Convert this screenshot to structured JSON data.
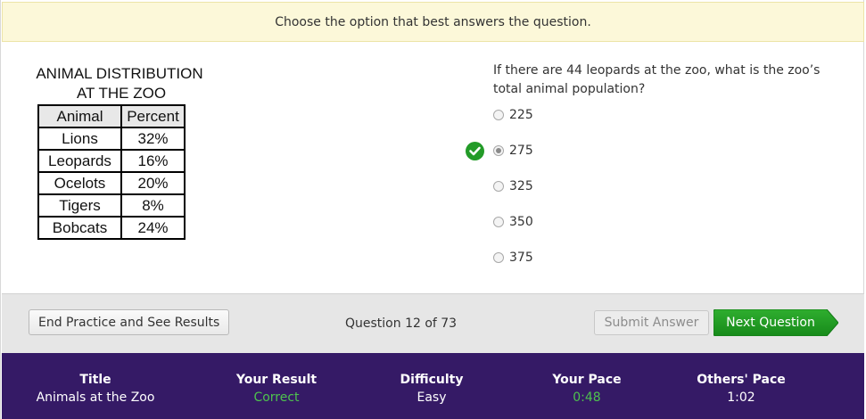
{
  "instruction": "Choose the option that best answers the question.",
  "figure": {
    "title_line1": "ANIMAL DISTRIBUTION",
    "title_line2": "AT THE ZOO",
    "headers": [
      "Animal",
      "Percent"
    ],
    "rows": [
      [
        "Lions",
        "32%"
      ],
      [
        "Leopards",
        "16%"
      ],
      [
        "Ocelots",
        "20%"
      ],
      [
        "Tigers",
        "8%"
      ],
      [
        "Bobcats",
        "24%"
      ]
    ]
  },
  "question": {
    "text": "If there are 44 leopards at the zoo, what is the zoo’s total animal population?",
    "options": [
      "225",
      "275",
      "325",
      "350",
      "375"
    ],
    "selected_index": 1,
    "correct_index": 1
  },
  "actions": {
    "end_label": "End Practice and See Results",
    "question_count": "Question 12 of 73",
    "submit_label": "Submit Answer",
    "next_label": "Next Question"
  },
  "footer": {
    "title_label": "Title",
    "title_value": "Animals at the Zoo",
    "result_label": "Your Result",
    "result_value": "Correct",
    "difficulty_label": "Difficulty",
    "difficulty_value": "Easy",
    "pace_label": "Your Pace",
    "pace_value": "0:48",
    "others_label": "Others' Pace",
    "others_value": "1:02"
  },
  "colors": {
    "footer_bg": "#351a66",
    "accent_green": "#239b28",
    "correct_text": "#4ec24e",
    "instruction_bg": "#fcf8d9"
  },
  "icons": {
    "correct": "check-circle-icon"
  }
}
